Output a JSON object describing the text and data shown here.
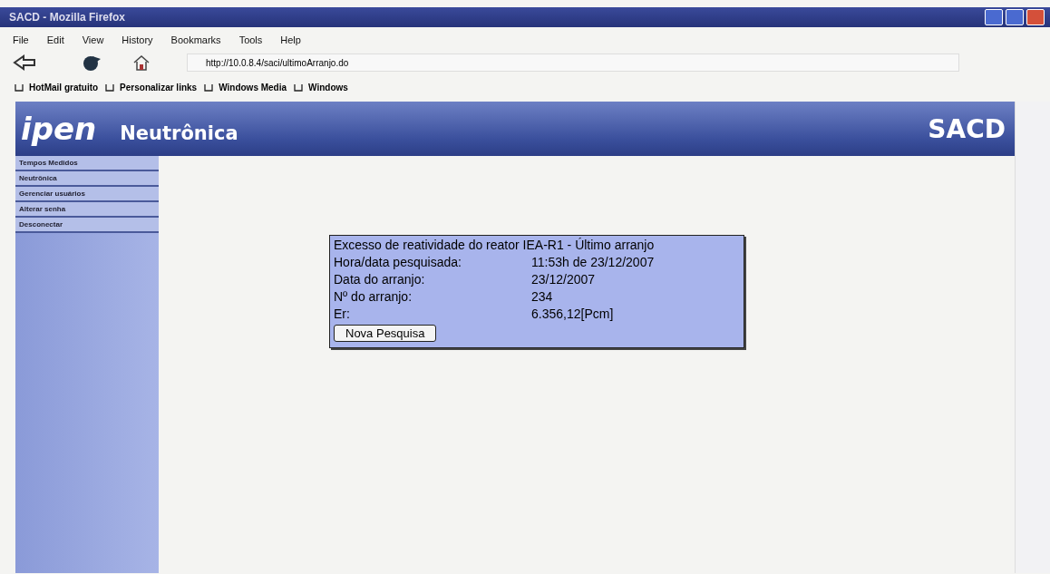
{
  "window": {
    "title": "SACD - Mozilla Firefox"
  },
  "menu": [
    "File",
    "Edit",
    "View",
    "History",
    "Bookmarks",
    "Tools",
    "Help"
  ],
  "address": {
    "value": "http://10.0.8.4/saci/ultimoArranjo.do"
  },
  "bookmarks": [
    "HotMail gratuito",
    "Personalizar links",
    "Windows Media",
    "Windows"
  ],
  "header": {
    "logo": "ipen",
    "section": "Neutrônica",
    "system": "SACD"
  },
  "sidebar": {
    "items": [
      "Tempos Medidos",
      "Neutrônica",
      "Gerenciar usuários",
      "Alterar senha",
      "Desconectar"
    ]
  },
  "result": {
    "title": "Excesso de reatividade do reator IEA-R1 - Último arranjo",
    "rows": [
      {
        "label": "Hora/data pesquisada:",
        "value": "11:53h de 23/12/2007"
      },
      {
        "label": "Data do arranjo:",
        "value": "23/12/2007"
      },
      {
        "label": "Nº do arranjo:",
        "value": "234"
      },
      {
        "label": "Er:",
        "value": "6.356,12[Pcm]"
      }
    ],
    "button": "Nova Pesquisa"
  }
}
